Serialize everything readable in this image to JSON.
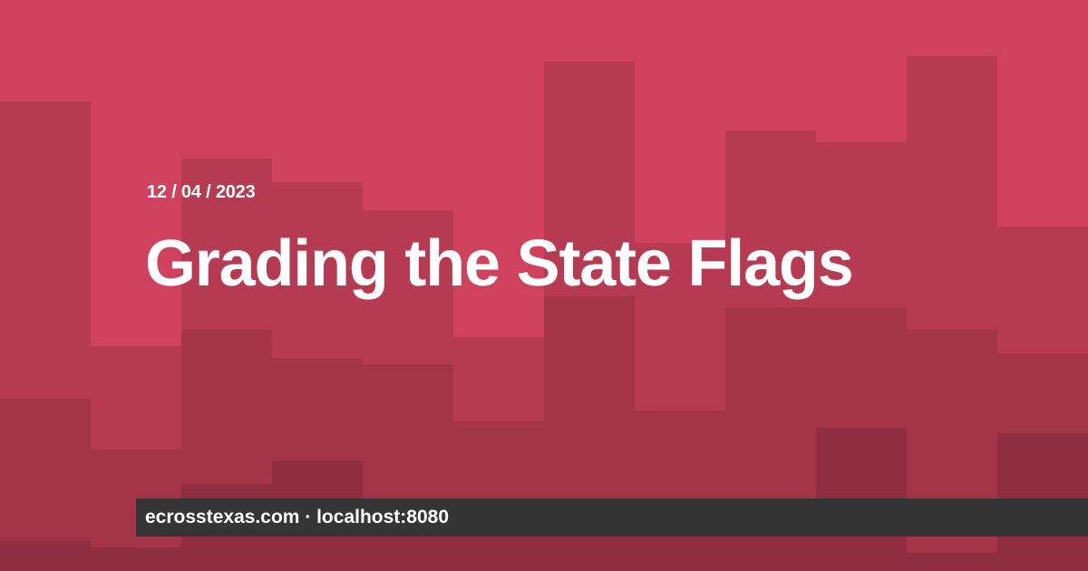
{
  "post": {
    "date": "12 / 04 / 2023",
    "title": "Grading the State Flags"
  },
  "footer": {
    "site": "ecrosstexas.com · localhost:8080"
  },
  "colors": {
    "background": "#cf415c",
    "pattern_light": "#b63a51",
    "pattern_medium": "#a43549",
    "pattern_dark": "#8f2d41",
    "footer_bar": "#353535",
    "text": "#ffffff"
  }
}
